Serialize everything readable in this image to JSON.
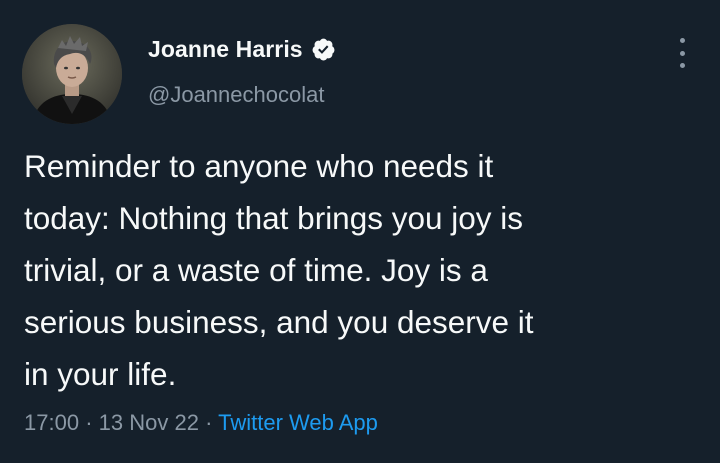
{
  "author": {
    "display_name": "Joanne Harris",
    "handle": "@Joannechocolat",
    "verified_icon": "verified-badge-icon",
    "avatar_icon": "profile-photo"
  },
  "tweet": {
    "lines": [
      "Reminder to anyone who needs it",
      "today: Nothing that brings you joy is",
      "trivial, or a waste of time. Joy is a",
      "serious business, and you deserve it",
      "in your life."
    ]
  },
  "meta": {
    "time": "17:00",
    "separator": "·",
    "date": "13 Nov 22",
    "source": "Twitter Web App"
  },
  "colors": {
    "background": "#15202b",
    "text": "#f7f9f9",
    "secondary": "#8b98a5",
    "accent": "#1d9bf0"
  },
  "icons": {
    "more": "more-options-icon"
  }
}
